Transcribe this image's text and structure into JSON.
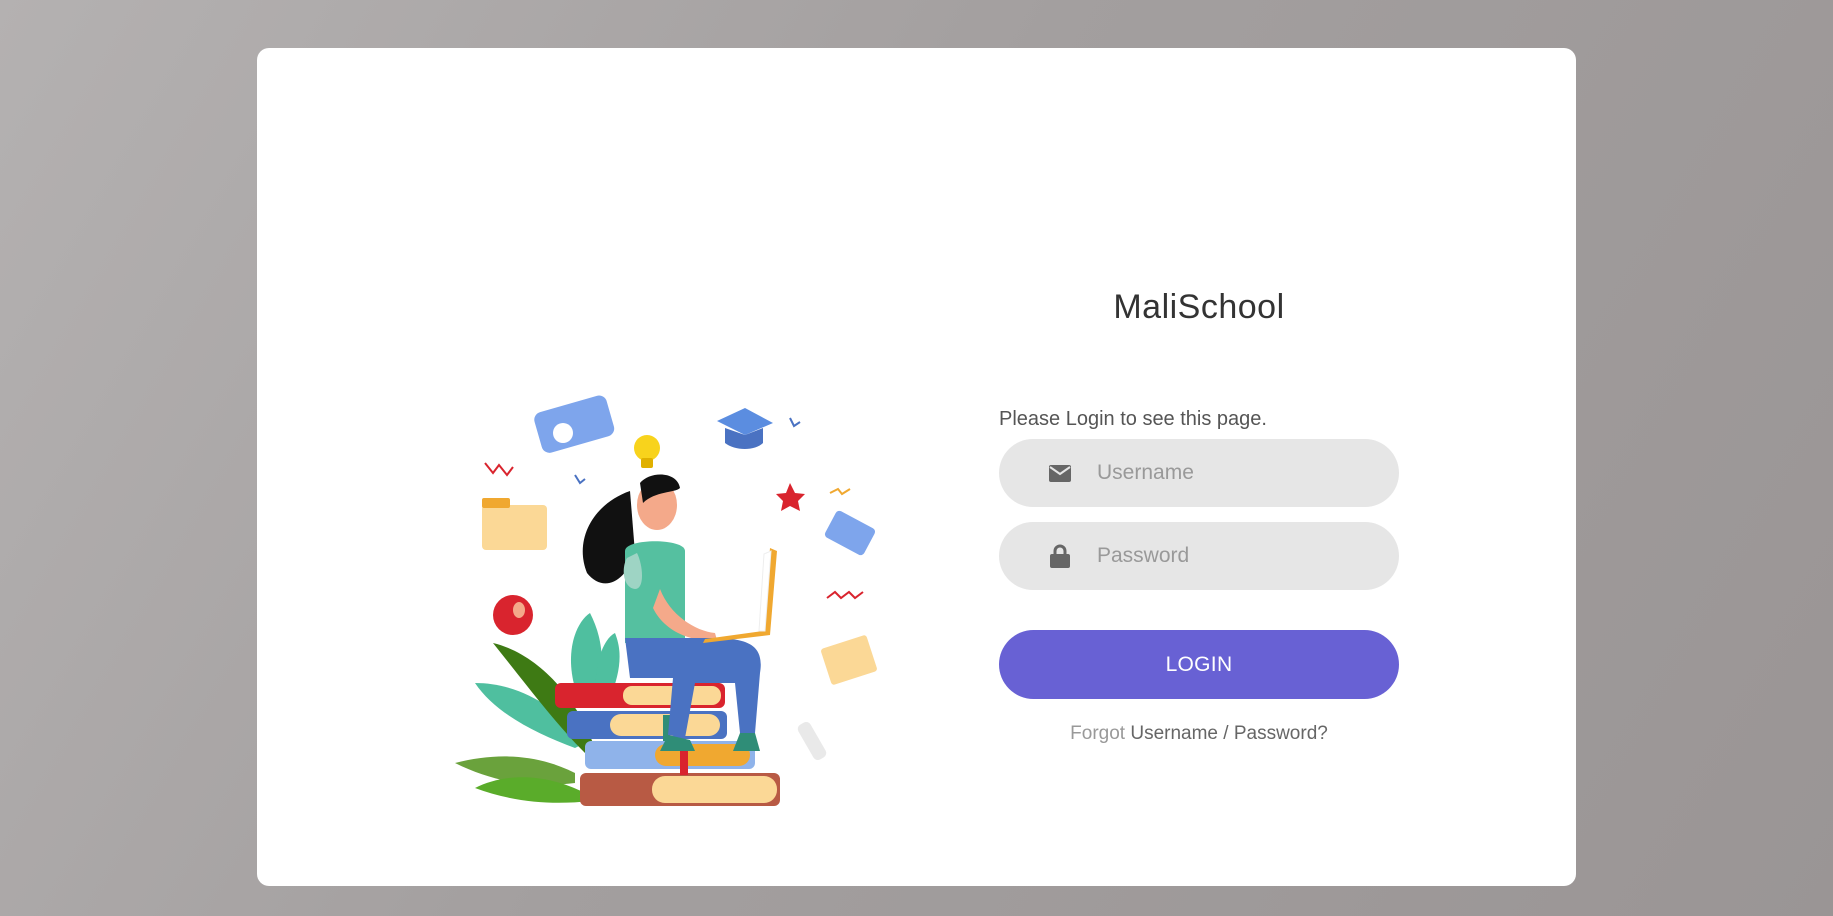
{
  "brand": {
    "name": "MaliSchool"
  },
  "login": {
    "intro": "Please Login to see this page.",
    "username_placeholder": "Username",
    "password_placeholder": "Password",
    "submit_label": "LOGIN",
    "forgot_prefix": "Forgot",
    "forgot_link": "Username / Password?"
  },
  "icons": {
    "username": "envelope-icon",
    "password": "lock-icon"
  },
  "colors": {
    "background": "#a39f9f",
    "card": "#ffffff",
    "input_bg": "#e6e6e6",
    "accent": "#6861d4",
    "icon": "#666666"
  }
}
